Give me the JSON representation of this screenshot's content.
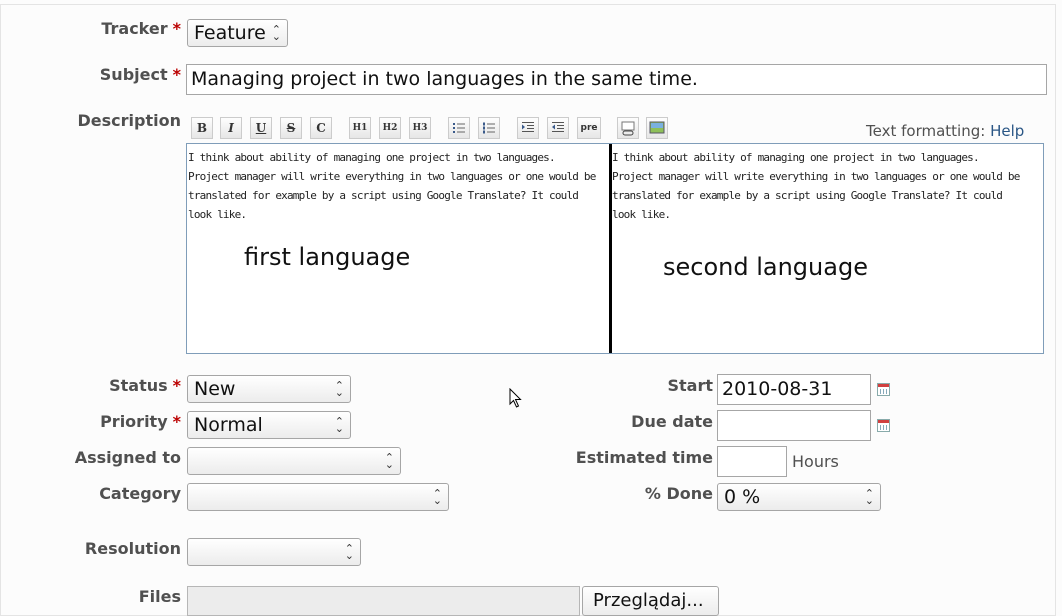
{
  "tracker": {
    "label": "Tracker",
    "value": "Feature"
  },
  "subject": {
    "label": "Subject",
    "value": "Managing project in two languages in the same time."
  },
  "description": {
    "label": "Description",
    "toolbar": [
      "B",
      "I",
      "U",
      "S",
      "C",
      "H1",
      "H2",
      "H3",
      "ul",
      "ol",
      "indent-right",
      "indent-left",
      "pre",
      "link",
      "image"
    ],
    "toolbar_pre_label": "pre",
    "formatting_label": "Text formatting:",
    "help_link": "Help",
    "text": "I think about ability of managing one project in two languages. Project manager will write everything in two languages or one would be translated for example by a script using Google Translate? It could look like.",
    "left_caption": "first language",
    "right_caption": "second language"
  },
  "status": {
    "label": "Status",
    "value": "New"
  },
  "priority": {
    "label": "Priority",
    "value": "Normal"
  },
  "assigned_to": {
    "label": "Assigned to",
    "value": ""
  },
  "category": {
    "label": "Category",
    "value": ""
  },
  "resolution": {
    "label": "Resolution",
    "value": ""
  },
  "start": {
    "label": "Start",
    "value": "2010-08-31"
  },
  "due_date": {
    "label": "Due date",
    "value": ""
  },
  "estimated_time": {
    "label": "Estimated time",
    "value": "",
    "unit": "Hours"
  },
  "done": {
    "label": "% Done",
    "value": "0 %"
  },
  "files": {
    "label": "Files",
    "browse_label": "Przeglądaj..."
  },
  "required_mark": "*",
  "colors": {
    "required": "#bb0000",
    "link": "#2a5685",
    "editor_border": "#7f9db9"
  }
}
